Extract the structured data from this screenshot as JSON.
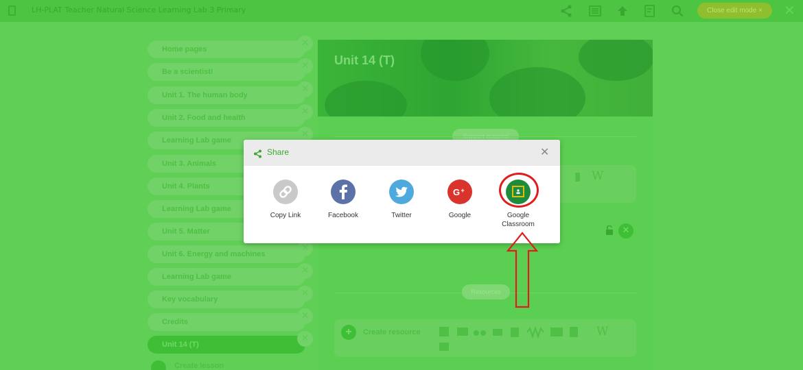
{
  "app": {
    "title": "LH-PLAT Teacher Natural Science Learning Lab 3 Primary",
    "close_edit_mode": "Close edit mode ×"
  },
  "toolbar": {
    "icons": [
      "share-icon",
      "list-icon",
      "upload-icon",
      "edit-icon",
      "search-icon",
      "close-icon"
    ]
  },
  "sidebar": {
    "items": [
      {
        "label": "Home pages"
      },
      {
        "label": "Be a scientist!"
      },
      {
        "label": "Unit 1. The human body"
      },
      {
        "label": "Unit 2. Food and health"
      },
      {
        "label": "Learning Lab game"
      },
      {
        "label": "Unit 3. Animals"
      },
      {
        "label": "Unit 4. Plants"
      },
      {
        "label": "Learning Lab game"
      },
      {
        "label": "Unit 5. Matter"
      },
      {
        "label": "Unit 6. Energy and machines"
      },
      {
        "label": "Learning Lab game"
      },
      {
        "label": "Key vocabulary"
      },
      {
        "label": "Credits"
      },
      {
        "label": "Unit 14  (T)",
        "active": true
      }
    ],
    "create_lesson": "Create lesson"
  },
  "content": {
    "unit_title": "Unit 14  (T)",
    "section_pill_1": "Support material",
    "section_pill_2": "Resources",
    "create_resource": "Create resource"
  },
  "share_modal": {
    "title": "Share",
    "options": [
      {
        "label": "Copy Link",
        "color": "#c9c9c9",
        "icon": "link-icon"
      },
      {
        "label": "Facebook",
        "color": "#5b71a8",
        "icon": "facebook-icon"
      },
      {
        "label": "Twitter",
        "color": "#4ea9dd",
        "icon": "twitter-icon"
      },
      {
        "label": "Google",
        "color": "#d8342c",
        "icon": "google-plus-icon"
      },
      {
        "label": "Google\nClassroom",
        "color": "#1e8c3a",
        "icon": "google-classroom-icon"
      }
    ]
  },
  "colors": {
    "page_bg": "#5fcf55",
    "topbar": "#4ec443",
    "highlight": "#e01c1c"
  }
}
